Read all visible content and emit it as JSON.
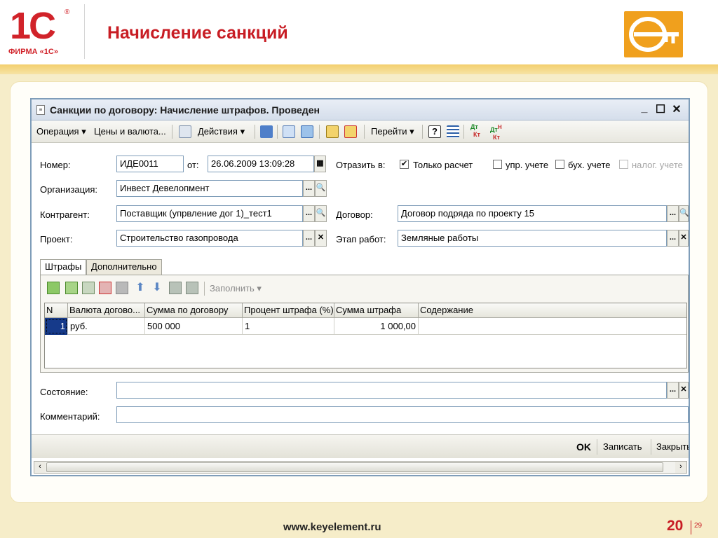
{
  "slide": {
    "title": "Начисление санкций",
    "website": "www.keyelement.ru",
    "page_number": "20",
    "slide_number": "29",
    "logo_1c_text": "1С",
    "logo_1c_reg": "®",
    "logo_1c_firm": "ФИРМА «1С»"
  },
  "window": {
    "title": "Санкции по договору: Начисление штрафов. Проведен",
    "controls": {
      "minimize": "_",
      "maximize": "☐",
      "close": "✕"
    }
  },
  "toolbar": {
    "operation": "Операция ▾",
    "prices": "Цены и валюта...",
    "actions": "Действия ▾",
    "goto": "Перейти ▾",
    "help": "?",
    "dt1": "Дт",
    "kt1": "Кт",
    "dt2": "Дт",
    "kt2": "Кт",
    "dt2_sup": "Н"
  },
  "form": {
    "number_label": "Номер:",
    "number_value": "ИДЕ0011",
    "date_label": "от:",
    "date_value": "26.06.2009 13:09:28",
    "reflect_label": "Отразить в:",
    "reflect_options": [
      {
        "label": "Только расчет",
        "checked": true,
        "enabled": true
      },
      {
        "label": "упр. учете",
        "checked": false,
        "enabled": true
      },
      {
        "label": "бух. учете",
        "checked": false,
        "enabled": true
      },
      {
        "label": "налог. учете",
        "checked": false,
        "enabled": false
      }
    ],
    "org_label": "Организация:",
    "org_value": "Инвест Девелопмент",
    "counterparty_label": "Контрагент:",
    "counterparty_value": "Поставщик (упрвление дог 1)_тест1",
    "contract_label": "Договор:",
    "contract_value": "Договор подряда по проекту 15",
    "project_label": "Проект:",
    "project_value": "Строительство газопровода",
    "stage_label": "Этап работ:",
    "stage_value": "Земляные работы",
    "state_label": "Состояние:",
    "state_value": "",
    "comment_label": "Комментарий:",
    "comment_value": "",
    "btn_select": "...",
    "btn_search": "🔍",
    "btn_clear": "✕"
  },
  "tabs": [
    {
      "label": "Штрафы",
      "active": true
    },
    {
      "label": "Дополнительно",
      "active": false
    }
  ],
  "grid_toolbar": {
    "fill": "Заполнить ▾"
  },
  "grid": {
    "columns": [
      "N",
      "Валюта догово...",
      "Сумма по договору",
      "Процент штрафа (%)",
      "Сумма штрафа",
      "Содержание"
    ],
    "rows": [
      {
        "n": "1",
        "currency": "руб.",
        "contract_sum": "500 000",
        "percent": "1",
        "penalty": "1 000,00",
        "content": ""
      }
    ]
  },
  "footer": {
    "ok": "OK",
    "save": "Записать",
    "close": "Закрыть"
  }
}
